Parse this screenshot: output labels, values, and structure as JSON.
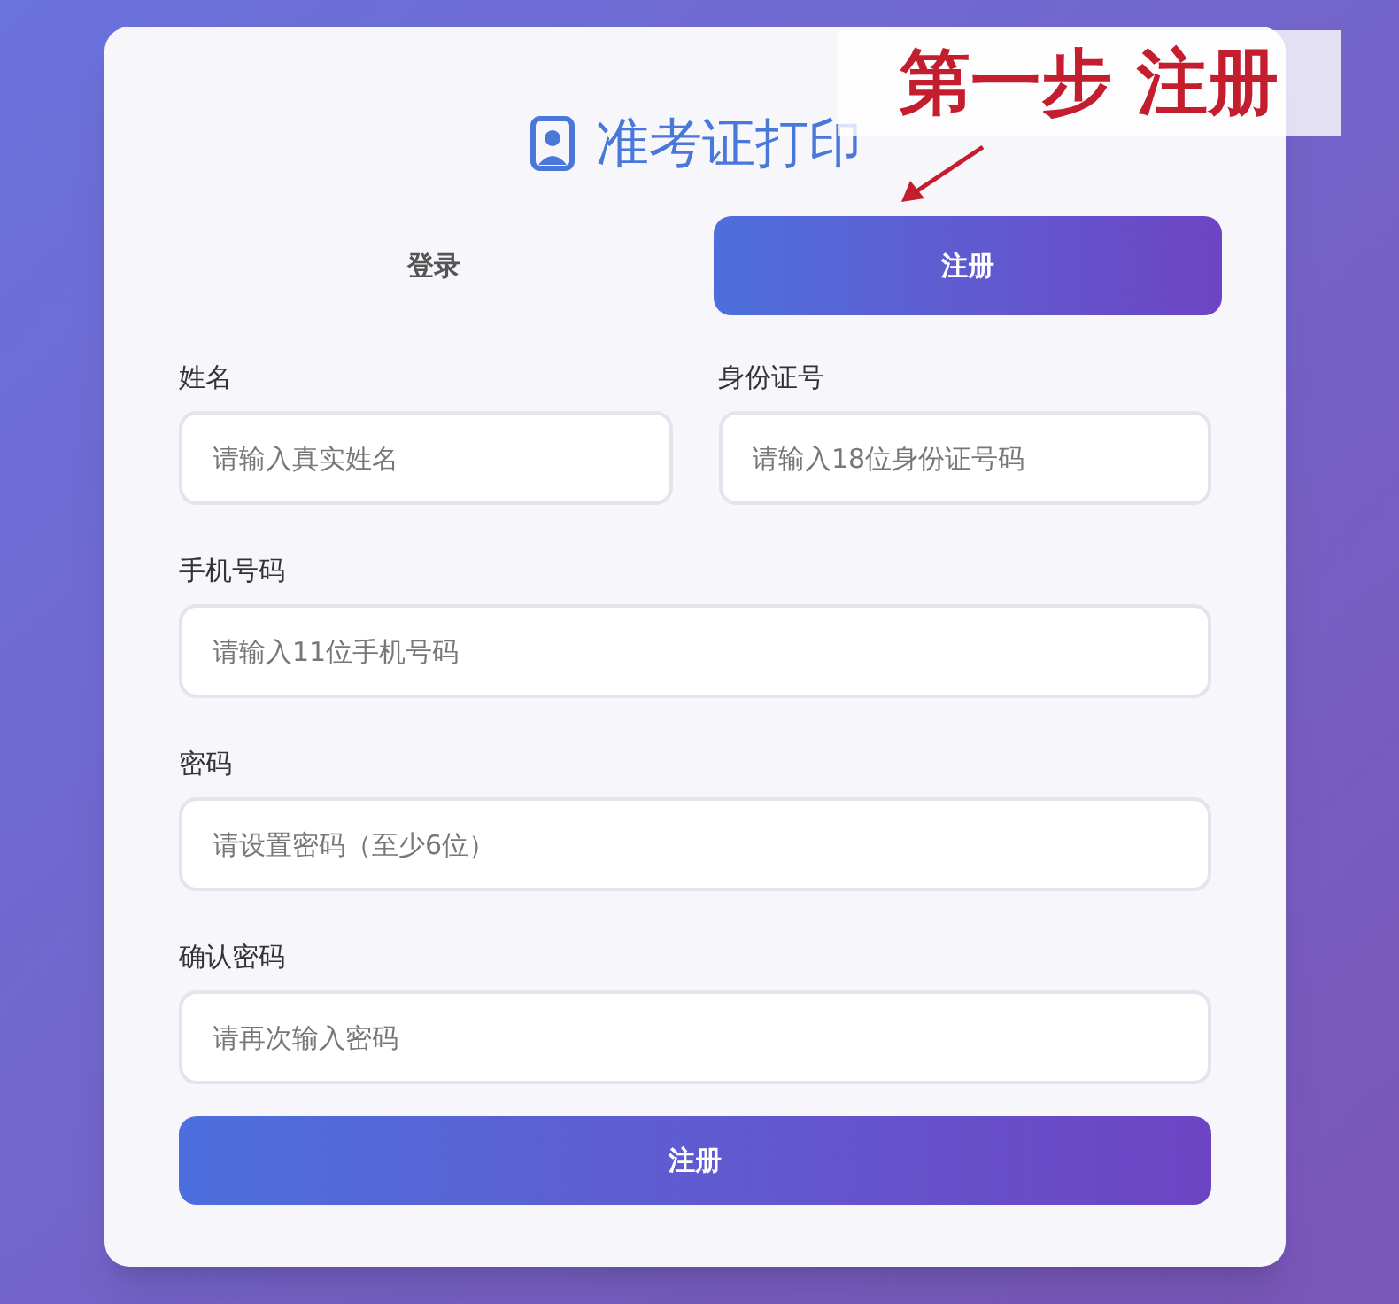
{
  "title": "准考证打印",
  "tabs": [
    {
      "label": "登录",
      "selected": false
    },
    {
      "label": "注册",
      "selected": true
    }
  ],
  "form_rows": [
    {
      "fields": [
        {
          "label": "姓名",
          "placeholder": "请输入真实姓名"
        },
        {
          "label": "身份证号",
          "placeholder": "请输入18位身份证号码"
        }
      ]
    },
    {
      "fields": [
        {
          "label": "手机号码",
          "placeholder": "请输入11位手机号码"
        }
      ]
    },
    {
      "fields": [
        {
          "label": "密码",
          "placeholder": "请设置密码（至少6位）"
        }
      ]
    },
    {
      "fields": [
        {
          "label": "确认密码",
          "placeholder": "请再次输入密码"
        }
      ]
    }
  ],
  "submit_button": "注册",
  "annotation": {
    "text": "第一步 注册"
  }
}
